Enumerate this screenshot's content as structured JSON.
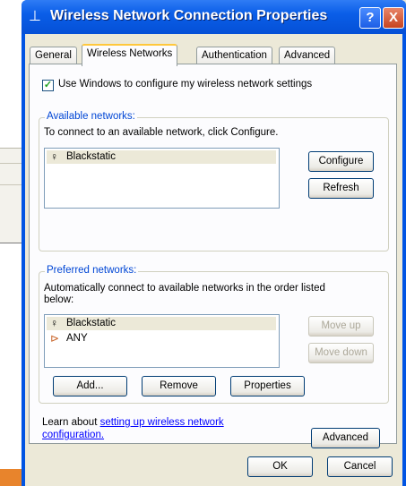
{
  "window": {
    "title": "Wireless Network Connection Properties",
    "help_label": "?",
    "close_label": "X"
  },
  "tabs": [
    {
      "label": "General"
    },
    {
      "label": "Wireless Networks"
    },
    {
      "label": "Authentication"
    },
    {
      "label": "Advanced"
    }
  ],
  "use_windows_checkbox": {
    "label": "Use Windows to configure my wireless network settings",
    "checked": true
  },
  "available": {
    "group_title": "Available networks:",
    "description": "To connect to an available network, click Configure.",
    "networks": [
      "Blackstatic"
    ],
    "configure_label": "Configure",
    "refresh_label": "Refresh"
  },
  "preferred": {
    "group_title": "Preferred networks:",
    "description_line1": "Automatically connect to available networks in the order listed",
    "description_line2": "below:",
    "networks": [
      "Blackstatic",
      "ANY"
    ],
    "move_up_label": "Move up",
    "move_down_label": "Move down",
    "add_label": "Add...",
    "remove_label": "Remove",
    "properties_label": "Properties"
  },
  "learn": {
    "prefix": "Learn about ",
    "link_line1": "setting up wireless network",
    "link_line2": "configuration.",
    "advanced_label": "Advanced"
  },
  "footer": {
    "ok_label": "OK",
    "cancel_label": "Cancel"
  }
}
